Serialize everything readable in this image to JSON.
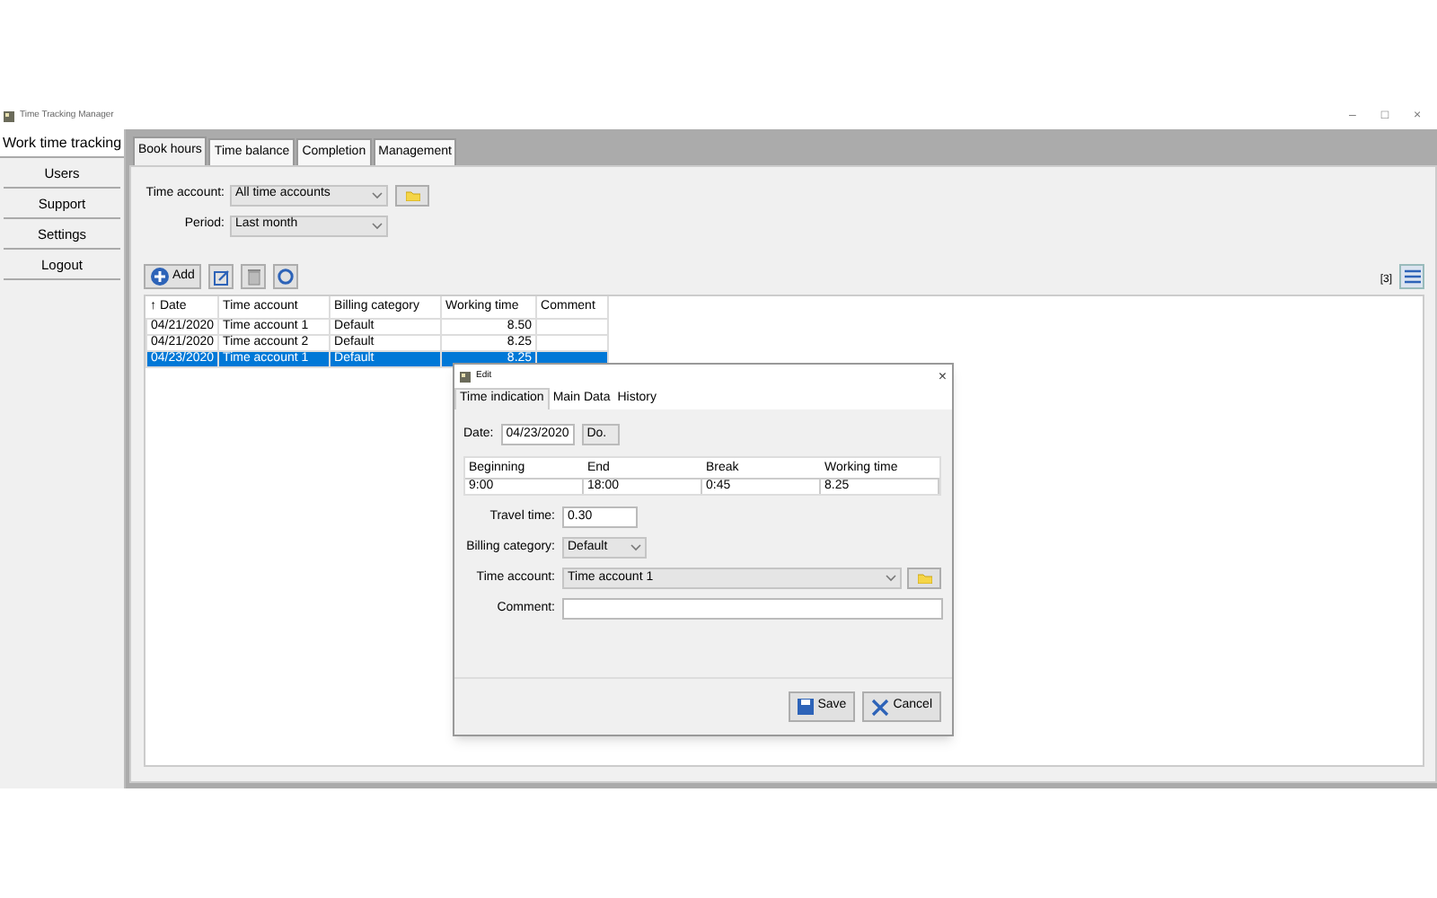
{
  "window": {
    "title": "Time Tracking Manager",
    "controls": [
      "–",
      "□",
      "×"
    ]
  },
  "sidebar": {
    "items": [
      {
        "label": "Work time tracking",
        "selected": true
      },
      {
        "label": "Users",
        "selected": false
      },
      {
        "label": "Support",
        "selected": false
      },
      {
        "label": "Settings",
        "selected": false
      },
      {
        "label": "Logout",
        "selected": false
      }
    ]
  },
  "tabs": [
    {
      "label": "Book hours",
      "selected": true
    },
    {
      "label": "Time balance",
      "selected": false
    },
    {
      "label": "Completion",
      "selected": false
    },
    {
      "label": "Management",
      "selected": false
    }
  ],
  "filters": [
    {
      "label": "Time account:",
      "value": "All time accounts",
      "folder": true
    },
    {
      "label": "Period:",
      "value": "Last month",
      "folder": false
    }
  ],
  "toolbar": {
    "add": "Add",
    "count": "[3]"
  },
  "table": {
    "columns": [
      "↑ Date",
      "Time account",
      "Billing category",
      "Working time",
      "Comment"
    ],
    "rows": [
      {
        "cells": [
          "04/21/2020",
          "Time account 1",
          "Default",
          "8.50",
          ""
        ],
        "selected": false
      },
      {
        "cells": [
          "04/21/2020",
          "Time account 2",
          "Default",
          "8.25",
          ""
        ],
        "selected": false
      },
      {
        "cells": [
          "04/23/2020",
          "Time account 1",
          "Default",
          "8.25",
          ""
        ],
        "selected": true
      }
    ]
  },
  "dialog": {
    "title": "Edit",
    "close": "×",
    "tabs": [
      {
        "label": "Time indication",
        "selected": true
      },
      {
        "label": "Main Data",
        "selected": false
      },
      {
        "label": "History",
        "selected": false
      }
    ],
    "date_label": "Date:",
    "date": "04/23/2020",
    "weekday": "Do.",
    "times": {
      "columns": [
        "Beginning",
        "End",
        "Break",
        "Working time"
      ],
      "values": [
        "9:00",
        "18:00",
        "0:45",
        "8.25"
      ]
    },
    "travel_label": "Travel time:",
    "travel": "0.30",
    "billing_label": "Billing category:",
    "billing": "Default",
    "account_label": "Time account:",
    "account": "Time account 1",
    "comment_label": "Comment:",
    "buttons": [
      "Save",
      "Cancel"
    ]
  }
}
